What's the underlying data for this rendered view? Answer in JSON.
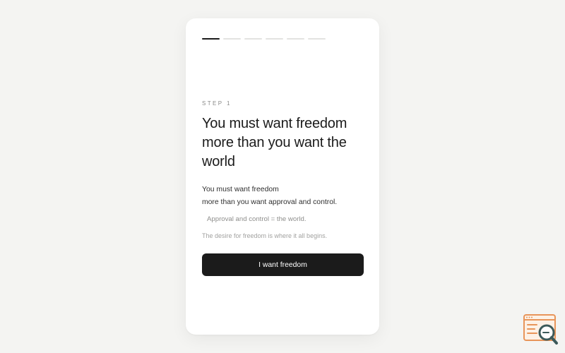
{
  "progress": {
    "total_steps": 6,
    "current_step": 1
  },
  "step": {
    "label": "STEP 1",
    "headline": "You must want freedom more than you want the world",
    "body_line_1": "You must want freedom",
    "body_line_2": "more than you want approval and control.",
    "quote": "Approval and control = the world.",
    "note": "The desire for freedom is where it all begins.",
    "button_label": "I want freedom"
  },
  "colors": {
    "background": "#f4f4f2",
    "card": "#ffffff",
    "primary": "#1b1b1b",
    "progress_inactive": "#e3e3e1",
    "logo_accent": "#e8955a",
    "logo_dark": "#3c5a5a"
  },
  "icons": {
    "corner_logo": "browser-search-icon"
  }
}
